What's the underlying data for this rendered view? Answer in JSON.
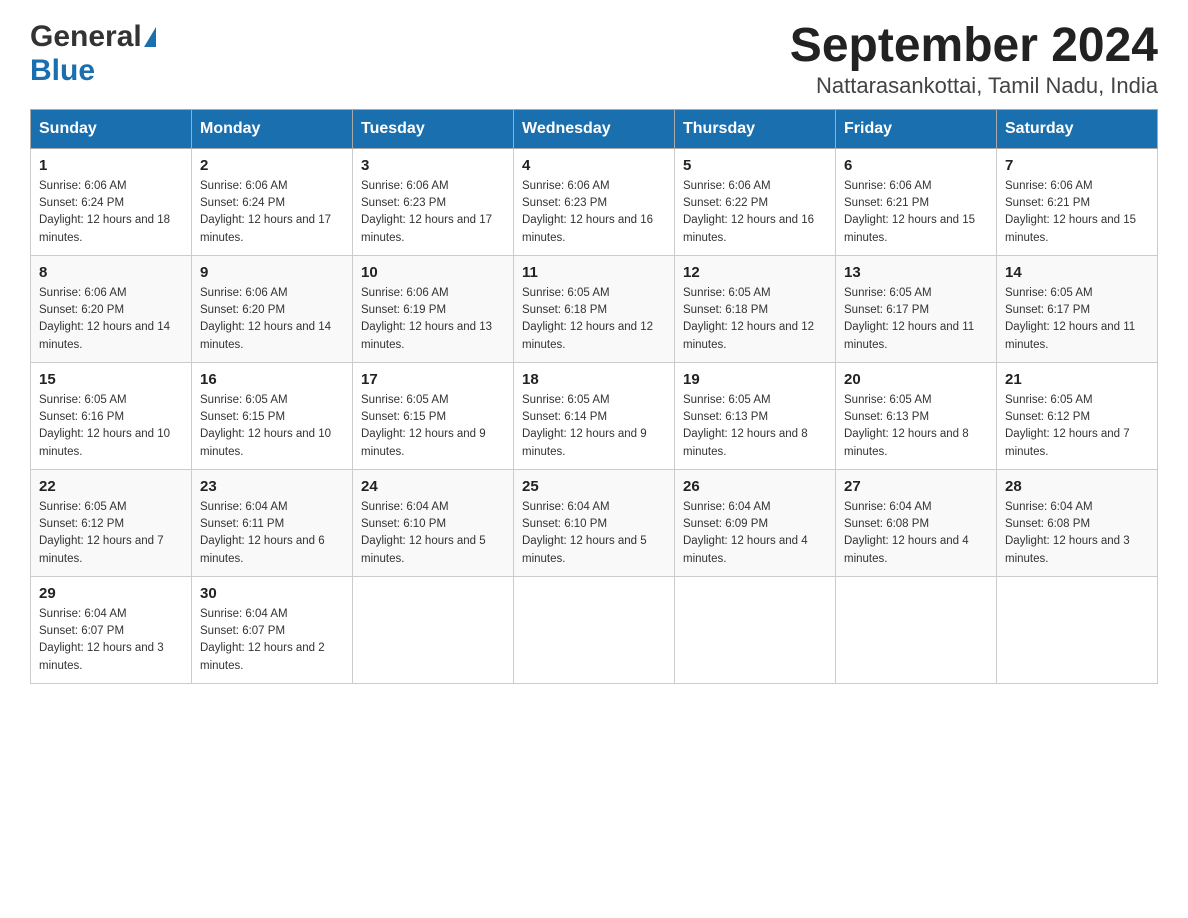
{
  "logo": {
    "general": "General",
    "blue": "Blue"
  },
  "title": "September 2024",
  "subtitle": "Nattarasankottai, Tamil Nadu, India",
  "days_of_week": [
    "Sunday",
    "Monday",
    "Tuesday",
    "Wednesday",
    "Thursday",
    "Friday",
    "Saturday"
  ],
  "weeks": [
    [
      {
        "day": "1",
        "sunrise": "6:06 AM",
        "sunset": "6:24 PM",
        "daylight": "12 hours and 18 minutes."
      },
      {
        "day": "2",
        "sunrise": "6:06 AM",
        "sunset": "6:24 PM",
        "daylight": "12 hours and 17 minutes."
      },
      {
        "day": "3",
        "sunrise": "6:06 AM",
        "sunset": "6:23 PM",
        "daylight": "12 hours and 17 minutes."
      },
      {
        "day": "4",
        "sunrise": "6:06 AM",
        "sunset": "6:23 PM",
        "daylight": "12 hours and 16 minutes."
      },
      {
        "day": "5",
        "sunrise": "6:06 AM",
        "sunset": "6:22 PM",
        "daylight": "12 hours and 16 minutes."
      },
      {
        "day": "6",
        "sunrise": "6:06 AM",
        "sunset": "6:21 PM",
        "daylight": "12 hours and 15 minutes."
      },
      {
        "day": "7",
        "sunrise": "6:06 AM",
        "sunset": "6:21 PM",
        "daylight": "12 hours and 15 minutes."
      }
    ],
    [
      {
        "day": "8",
        "sunrise": "6:06 AM",
        "sunset": "6:20 PM",
        "daylight": "12 hours and 14 minutes."
      },
      {
        "day": "9",
        "sunrise": "6:06 AM",
        "sunset": "6:20 PM",
        "daylight": "12 hours and 14 minutes."
      },
      {
        "day": "10",
        "sunrise": "6:06 AM",
        "sunset": "6:19 PM",
        "daylight": "12 hours and 13 minutes."
      },
      {
        "day": "11",
        "sunrise": "6:05 AM",
        "sunset": "6:18 PM",
        "daylight": "12 hours and 12 minutes."
      },
      {
        "day": "12",
        "sunrise": "6:05 AM",
        "sunset": "6:18 PM",
        "daylight": "12 hours and 12 minutes."
      },
      {
        "day": "13",
        "sunrise": "6:05 AM",
        "sunset": "6:17 PM",
        "daylight": "12 hours and 11 minutes."
      },
      {
        "day": "14",
        "sunrise": "6:05 AM",
        "sunset": "6:17 PM",
        "daylight": "12 hours and 11 minutes."
      }
    ],
    [
      {
        "day": "15",
        "sunrise": "6:05 AM",
        "sunset": "6:16 PM",
        "daylight": "12 hours and 10 minutes."
      },
      {
        "day": "16",
        "sunrise": "6:05 AM",
        "sunset": "6:15 PM",
        "daylight": "12 hours and 10 minutes."
      },
      {
        "day": "17",
        "sunrise": "6:05 AM",
        "sunset": "6:15 PM",
        "daylight": "12 hours and 9 minutes."
      },
      {
        "day": "18",
        "sunrise": "6:05 AM",
        "sunset": "6:14 PM",
        "daylight": "12 hours and 9 minutes."
      },
      {
        "day": "19",
        "sunrise": "6:05 AM",
        "sunset": "6:13 PM",
        "daylight": "12 hours and 8 minutes."
      },
      {
        "day": "20",
        "sunrise": "6:05 AM",
        "sunset": "6:13 PM",
        "daylight": "12 hours and 8 minutes."
      },
      {
        "day": "21",
        "sunrise": "6:05 AM",
        "sunset": "6:12 PM",
        "daylight": "12 hours and 7 minutes."
      }
    ],
    [
      {
        "day": "22",
        "sunrise": "6:05 AM",
        "sunset": "6:12 PM",
        "daylight": "12 hours and 7 minutes."
      },
      {
        "day": "23",
        "sunrise": "6:04 AM",
        "sunset": "6:11 PM",
        "daylight": "12 hours and 6 minutes."
      },
      {
        "day": "24",
        "sunrise": "6:04 AM",
        "sunset": "6:10 PM",
        "daylight": "12 hours and 5 minutes."
      },
      {
        "day": "25",
        "sunrise": "6:04 AM",
        "sunset": "6:10 PM",
        "daylight": "12 hours and 5 minutes."
      },
      {
        "day": "26",
        "sunrise": "6:04 AM",
        "sunset": "6:09 PM",
        "daylight": "12 hours and 4 minutes."
      },
      {
        "day": "27",
        "sunrise": "6:04 AM",
        "sunset": "6:08 PM",
        "daylight": "12 hours and 4 minutes."
      },
      {
        "day": "28",
        "sunrise": "6:04 AM",
        "sunset": "6:08 PM",
        "daylight": "12 hours and 3 minutes."
      }
    ],
    [
      {
        "day": "29",
        "sunrise": "6:04 AM",
        "sunset": "6:07 PM",
        "daylight": "12 hours and 3 minutes."
      },
      {
        "day": "30",
        "sunrise": "6:04 AM",
        "sunset": "6:07 PM",
        "daylight": "12 hours and 2 minutes."
      },
      null,
      null,
      null,
      null,
      null
    ]
  ]
}
